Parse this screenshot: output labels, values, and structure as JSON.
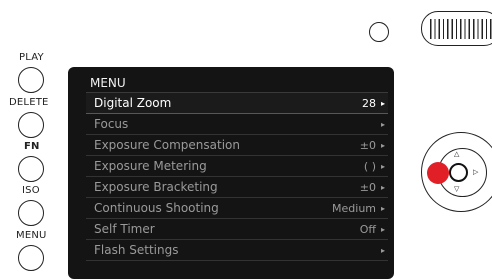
{
  "side_buttons": [
    {
      "label": "PLAY",
      "bold": false
    },
    {
      "label": "DELETE",
      "bold": false
    },
    {
      "label": "FN",
      "bold": true
    },
    {
      "label": "ISO",
      "bold": false
    },
    {
      "label": "MENU",
      "bold": false
    }
  ],
  "menu": {
    "title": "MENU",
    "items": [
      {
        "label": "Digital Zoom",
        "value": "28",
        "selected": true
      },
      {
        "label": "Focus",
        "value": "",
        "selected": false
      },
      {
        "label": "Exposure Compensation",
        "value": "±0",
        "selected": false
      },
      {
        "label": "Exposure Metering",
        "value": "",
        "icon": "center-weighted-metering-icon",
        "selected": false
      },
      {
        "label": "Exposure Bracketing",
        "value": "±0",
        "selected": false
      },
      {
        "label": "Continuous Shooting",
        "value": "Medium",
        "selected": false
      },
      {
        "label": "Self Timer",
        "value": "Off",
        "selected": false
      },
      {
        "label": "Flash Settings",
        "value": "",
        "selected": false
      }
    ]
  },
  "icons": {
    "row_arrow": "▸",
    "dpad_up": "△",
    "dpad_down": "▽",
    "dpad_right": "▷",
    "metering": "( )"
  },
  "colors": {
    "accent": "#e01f26",
    "selection_underline": "#c62828",
    "screen_bg": "#141414",
    "text_selected": "#ffffff",
    "text_normal": "#9a9a9a"
  }
}
